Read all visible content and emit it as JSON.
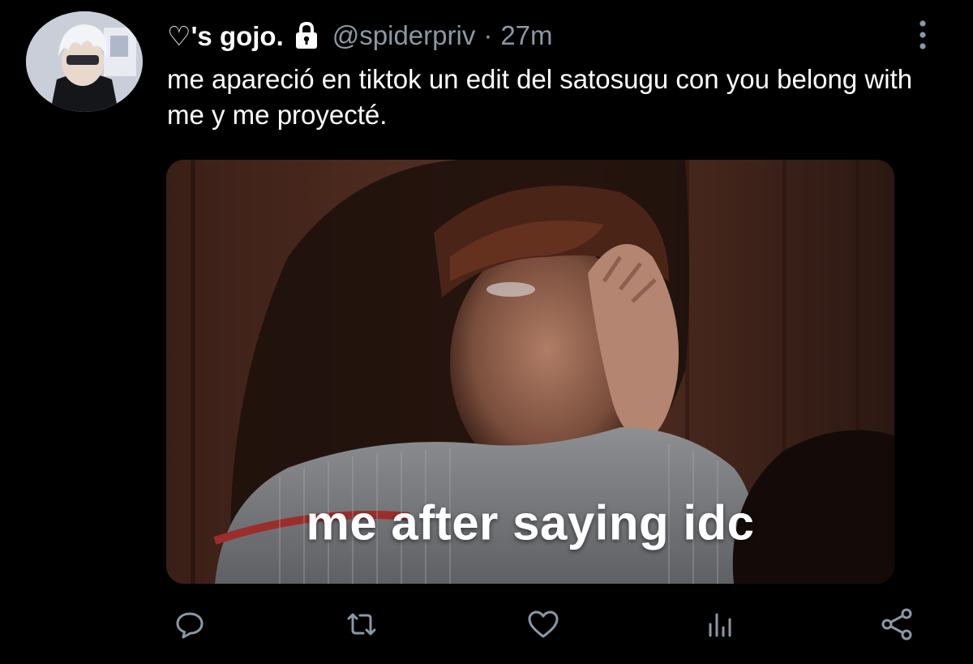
{
  "tweet": {
    "display_name": "♡'s gojo.",
    "handle": "@spiderpriv",
    "separator": "·",
    "time": "27m",
    "text": "me apareció en tiktok un edit del satosugu con you belong with me y me proyecté.",
    "media": {
      "caption": "me after saying idc"
    },
    "icons": {
      "avatar": "avatar",
      "protected": "lock-icon",
      "more": "more-vertical-icon",
      "reply": "reply-icon",
      "retweet": "retweet-icon",
      "like": "heart-icon",
      "analytics": "analytics-icon",
      "share": "share-icon"
    }
  },
  "colors": {
    "background": "#000000",
    "text_primary": "#ffffff",
    "text_secondary": "#8b98a5",
    "icon": "#8b98a5"
  }
}
